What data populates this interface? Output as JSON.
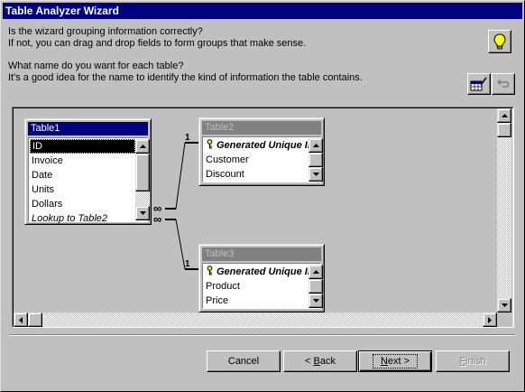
{
  "window": {
    "title": "Table Analyzer Wizard"
  },
  "instructions": {
    "line1": "Is the wizard grouping information correctly?",
    "line2": "If not, you can drag and drop fields to form groups that make sense.",
    "line3": "What name do you want for each table?",
    "line4": "It's a good idea for the name to identify the kind of information the table contains."
  },
  "toolbar": {
    "tips_icon": "lightbulb-icon",
    "rename_icon": "rename-table-icon",
    "undo_icon": "undo-icon"
  },
  "tables": [
    {
      "title": "Table1",
      "active": true,
      "fields": [
        "ID",
        "Invoice",
        "Date",
        "Units",
        "Dollars",
        "Lookup to Table2"
      ],
      "selected": "ID"
    },
    {
      "title": "Table2",
      "active": false,
      "key_field": "Generated Unique ID",
      "fields": [
        "Customer",
        "Discount"
      ]
    },
    {
      "title": "Table3",
      "active": false,
      "key_field": "Generated Unique ID",
      "fields": [
        "Product",
        "Price"
      ]
    }
  ],
  "relationships": [
    {
      "from": "Table1",
      "to": "Table2",
      "one_label": "1",
      "many_symbol": "∞"
    },
    {
      "from": "Table1",
      "to": "Table3",
      "one_label": "1",
      "many_symbol": "∞"
    }
  ],
  "buttons": {
    "cancel": "Cancel",
    "back_prefix": "< ",
    "back_hotkey": "B",
    "back_rest": "ack",
    "next_hotkey": "N",
    "next_rest": "ext >",
    "finish_hotkey": "F",
    "finish_rest": "inish"
  },
  "colors": {
    "titlebar": "#000080",
    "face": "#c0c0c0",
    "inactive_title": "#808080"
  }
}
